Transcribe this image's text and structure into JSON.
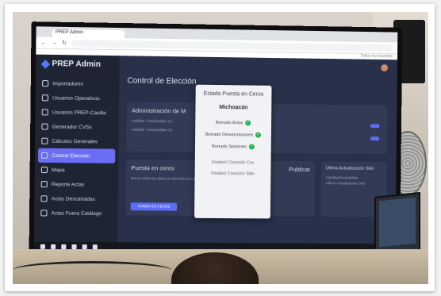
{
  "browser": {
    "tab_title": "PREP Admin",
    "address": "",
    "bookmark_label": "Todos los favoritos"
  },
  "app": {
    "brand": "PREP Admin",
    "menu": [
      {
        "label": "Importadores"
      },
      {
        "label": "Usuarios Operativos"
      },
      {
        "label": "Usuarios PREP-Casilla"
      },
      {
        "label": "Generador CVSs"
      },
      {
        "label": "Cálculos Generales"
      },
      {
        "label": "Control Elección"
      },
      {
        "label": "Mapa"
      },
      {
        "label": "Reporte Actas"
      },
      {
        "label": "Actas Descartadas"
      },
      {
        "label": "Actas Fuera Catálogo"
      }
    ],
    "page_title": "Control de Elección",
    "cards": {
      "admin_title": "Administración de M",
      "admin_row1": "Habilitar / Deshabilitar Ca",
      "admin_row2": "Habilitar / Deshabilitar Ca",
      "puesta_title": "Puesta en ceros",
      "puesta_desc": "Borrar todos los datos en elección en curso.",
      "puesta_button": "PONER EN CEROS",
      "publicar_title": "Publicar",
      "ultima_title": "Última Actualización Sitio",
      "ultima_row1": "Habilitar/Deshabilitar",
      "ultima_row2": "Última Actualización Sitio"
    },
    "modal": {
      "title": "Estado Puesta en Ceros",
      "subtitle": "Michoacán",
      "rows": [
        {
          "label": "Borrado Actas"
        },
        {
          "label": "Borrado Denunciaciones"
        },
        {
          "label": "Borrado Sesiones"
        }
      ],
      "pending_1": "Finalizó Creación Csv",
      "pending_2": "Finalizó Creación Sitio"
    }
  },
  "colors": {
    "sidebar": "#1f2433",
    "active": "#6b6df5",
    "check": "#27b34a"
  }
}
